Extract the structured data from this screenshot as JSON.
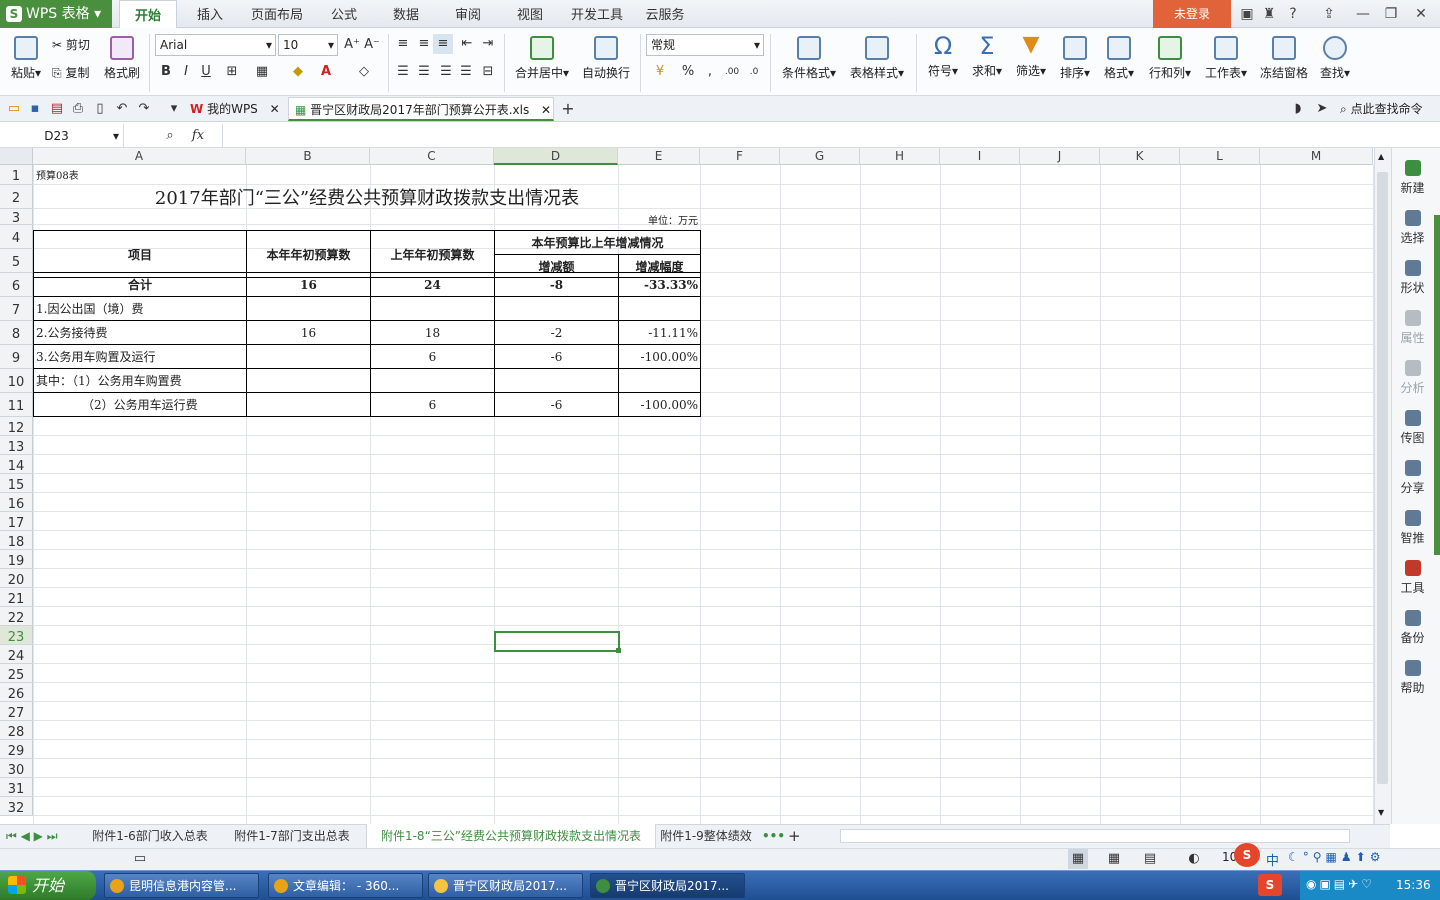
{
  "app": {
    "name": "WPS 表格",
    "login": "未登录"
  },
  "menu_tabs": [
    "开始",
    "插入",
    "页面布局",
    "公式",
    "数据",
    "审阅",
    "视图",
    "开发工具",
    "云服务"
  ],
  "ribbon": {
    "paste": "粘贴",
    "cut": "剪切",
    "copy": "复制",
    "format_painter": "格式刷",
    "font_name": "Arial",
    "font_size": "10",
    "merge_center": "合并居中",
    "auto_wrap": "自动换行",
    "number_format": "常规",
    "cond_format": "条件格式",
    "table_style": "表格样式",
    "symbol": "符号",
    "sum": "求和",
    "filter": "筛选",
    "sort": "排序",
    "format": "格式",
    "row_col": "行和列",
    "worksheet": "工作表",
    "freeze": "冻结窗格",
    "find": "查找"
  },
  "doc_tabs": {
    "my_wps": "我的WPS",
    "file": "晋宁区财政局2017年部门预算公开表.xls",
    "search_cmd": "点此查找命令"
  },
  "formula_bar": {
    "name_box": "D23",
    "fx": "fx",
    "value": ""
  },
  "columns": [
    "A",
    "B",
    "C",
    "D",
    "E",
    "F",
    "G",
    "H",
    "I",
    "J",
    "K",
    "L",
    "M"
  ],
  "rows": [
    "1",
    "2",
    "3",
    "4",
    "5",
    "6",
    "7",
    "8",
    "9",
    "10",
    "11",
    "12",
    "13",
    "14",
    "15",
    "16",
    "17",
    "18",
    "19",
    "20",
    "21",
    "22",
    "23",
    "24",
    "25",
    "26",
    "27",
    "28",
    "29",
    "30",
    "31",
    "32"
  ],
  "sheet": {
    "label_table": "预算08表",
    "title": "2017年部门“三公”经费公共预算财政拨款支出情况表",
    "unit": "单位：万元",
    "h_item": "项目",
    "h_this_year": "本年年初预算数",
    "h_last_year": "上年年初预算数",
    "h_change": "本年预算比上年增减情况",
    "h_amount": "增减额",
    "h_rate": "增减幅度",
    "data_rows": [
      {
        "item": "合计",
        "b": "16",
        "c": "24",
        "d": "-8",
        "e": "-33.33%"
      },
      {
        "item": "1.因公出国（境）费",
        "b": "",
        "c": "",
        "d": "",
        "e": ""
      },
      {
        "item": "2.公务接待费",
        "b": "16",
        "c": "18",
        "d": "-2",
        "e": "-11.11%"
      },
      {
        "item": "3.公务用车购置及运行",
        "b": "",
        "c": "6",
        "d": "-6",
        "e": "-100.00%"
      },
      {
        "item": "其中：（1）公务用车购置费",
        "b": "",
        "c": "",
        "d": "",
        "e": ""
      },
      {
        "item": "（2）公务用车运行费",
        "b": "",
        "c": "6",
        "d": "-6",
        "e": "-100.00%"
      }
    ]
  },
  "right_panel": [
    "新建",
    "选择",
    "形状",
    "属性",
    "分析",
    "传图",
    "分享",
    "智推",
    "工具",
    "备份",
    "帮助"
  ],
  "sheet_tabs": [
    "附件1-6部门收入总表",
    "附件1-7部门支出总表",
    "附件1-8“三公”经费公共预算财政拨款支出情况表",
    "附件1-9整体绩效"
  ],
  "active_sheet_index": 2,
  "status": {
    "zoom": "10"
  },
  "taskbar": {
    "start": "开始",
    "items": [
      "昆明信息港内容管...",
      "文章编辑： - 360...",
      "晋宁区财政局2017...",
      "晋宁区财政局2017..."
    ],
    "clock": "15:36",
    "ime": "中"
  }
}
